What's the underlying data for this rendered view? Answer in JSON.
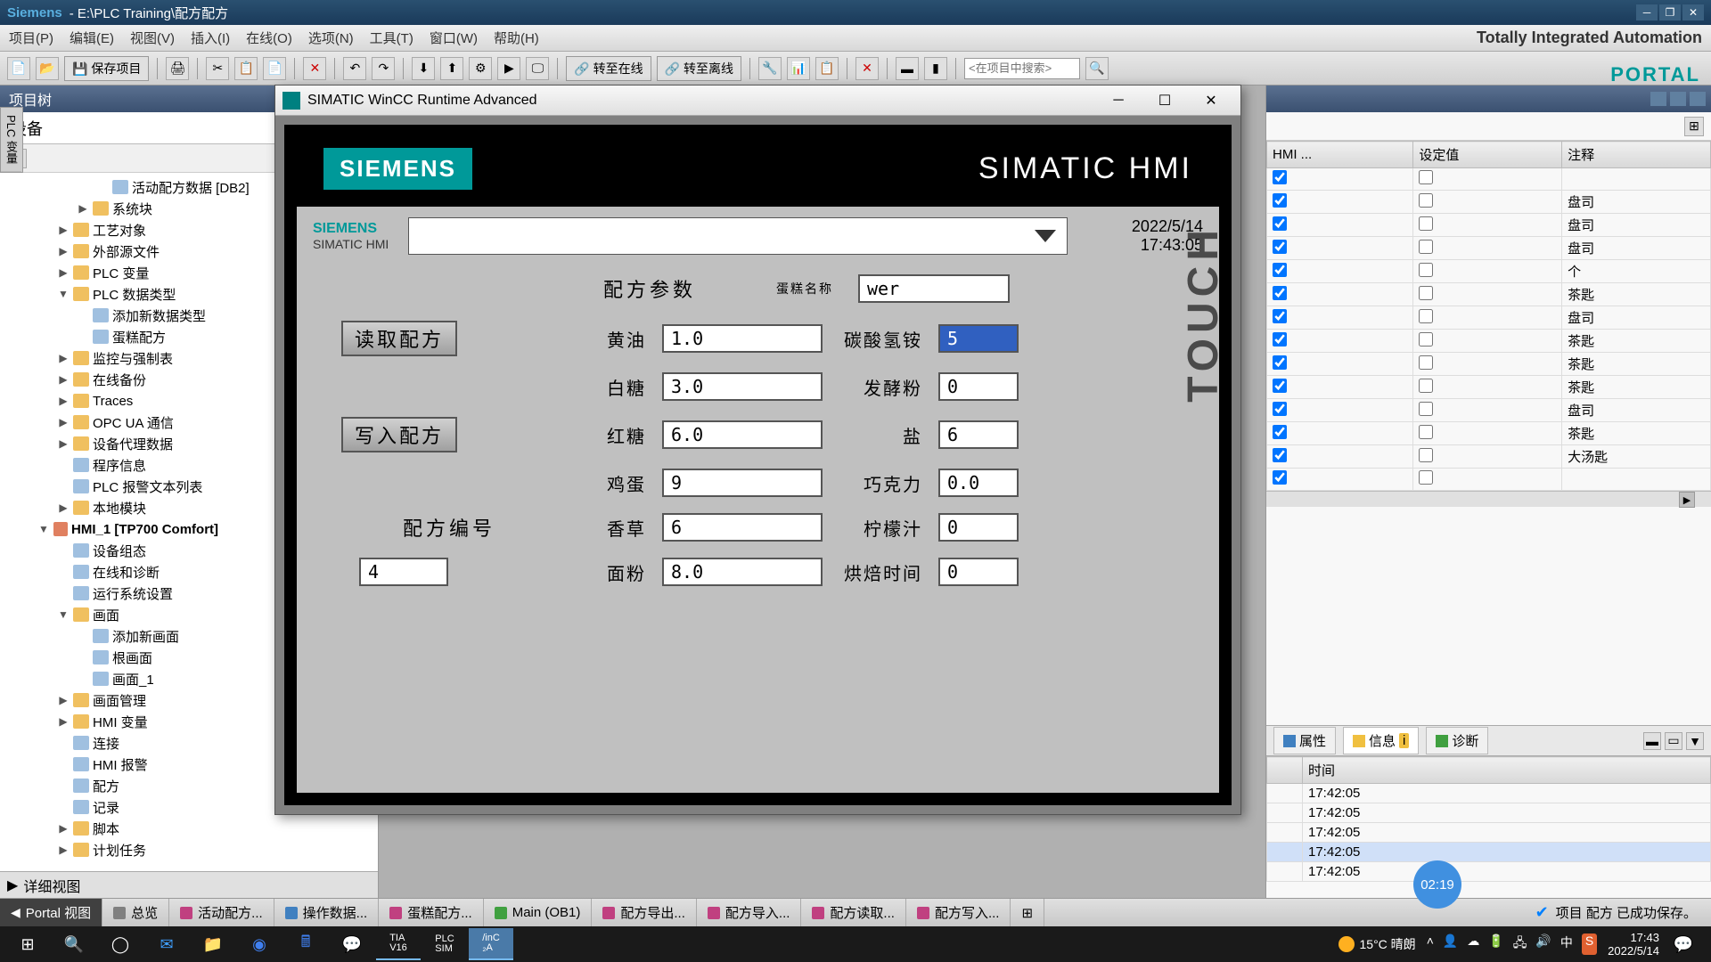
{
  "titlebar": {
    "logo": "Siemens",
    "path": "- E:\\PLC Training\\配方配方"
  },
  "menubar": {
    "items": [
      "项目(P)",
      "编辑(E)",
      "视图(V)",
      "插入(I)",
      "在线(O)",
      "选项(N)",
      "工具(T)",
      "窗口(W)",
      "帮助(H)"
    ],
    "brand": "Totally Integrated Automation"
  },
  "toolbar": {
    "save": "保存项目",
    "online": "转至在线",
    "offline": "转至离线",
    "search_placeholder": "<在项目中搜索>",
    "portal": "PORTAL"
  },
  "tree": {
    "title": "项目树",
    "device_tab": "设备",
    "detail": "详细视图",
    "left_rail": "PLC 变量",
    "nodes": [
      {
        "indent": 4,
        "icon": "file",
        "label": "活动配方数据 [DB2]"
      },
      {
        "indent": 3,
        "exp": "▶",
        "icon": "folder",
        "label": "系统块"
      },
      {
        "indent": 2,
        "exp": "▶",
        "icon": "folder",
        "label": "工艺对象"
      },
      {
        "indent": 2,
        "exp": "▶",
        "icon": "folder",
        "label": "外部源文件"
      },
      {
        "indent": 2,
        "exp": "▶",
        "icon": "folder",
        "label": "PLC 变量"
      },
      {
        "indent": 2,
        "exp": "▼",
        "icon": "folder",
        "label": "PLC 数据类型"
      },
      {
        "indent": 3,
        "icon": "file",
        "label": "添加新数据类型"
      },
      {
        "indent": 3,
        "icon": "file",
        "label": "蛋糕配方"
      },
      {
        "indent": 2,
        "exp": "▶",
        "icon": "folder",
        "label": "监控与强制表"
      },
      {
        "indent": 2,
        "exp": "▶",
        "icon": "folder",
        "label": "在线备份"
      },
      {
        "indent": 2,
        "exp": "▶",
        "icon": "folder",
        "label": "Traces"
      },
      {
        "indent": 2,
        "exp": "▶",
        "icon": "folder",
        "label": "OPC UA 通信"
      },
      {
        "indent": 2,
        "exp": "▶",
        "icon": "folder",
        "label": "设备代理数据"
      },
      {
        "indent": 2,
        "icon": "file",
        "label": "程序信息"
      },
      {
        "indent": 2,
        "icon": "file",
        "label": "PLC 报警文本列表"
      },
      {
        "indent": 2,
        "exp": "▶",
        "icon": "folder",
        "label": "本地模块"
      },
      {
        "indent": 1,
        "exp": "▼",
        "icon": "hmi",
        "label": "HMI_1 [TP700 Comfort]",
        "bold": true
      },
      {
        "indent": 2,
        "icon": "file",
        "label": "设备组态"
      },
      {
        "indent": 2,
        "icon": "file",
        "label": "在线和诊断"
      },
      {
        "indent": 2,
        "icon": "file",
        "label": "运行系统设置"
      },
      {
        "indent": 2,
        "exp": "▼",
        "icon": "folder",
        "label": "画面"
      },
      {
        "indent": 3,
        "icon": "file",
        "label": "添加新画面"
      },
      {
        "indent": 3,
        "icon": "file",
        "label": "根画面"
      },
      {
        "indent": 3,
        "icon": "file",
        "label": "画面_1"
      },
      {
        "indent": 2,
        "exp": "▶",
        "icon": "folder",
        "label": "画面管理"
      },
      {
        "indent": 2,
        "exp": "▶",
        "icon": "folder",
        "label": "HMI 变量"
      },
      {
        "indent": 2,
        "icon": "file",
        "label": "连接"
      },
      {
        "indent": 2,
        "icon": "file",
        "label": "HMI 报警"
      },
      {
        "indent": 2,
        "icon": "file",
        "label": "配方"
      },
      {
        "indent": 2,
        "icon": "file",
        "label": "记录"
      },
      {
        "indent": 2,
        "exp": "▶",
        "icon": "folder",
        "label": "脚本"
      },
      {
        "indent": 2,
        "exp": "▶",
        "icon": "folder",
        "label": "计划任务"
      }
    ]
  },
  "runtime": {
    "title": "SIMATIC WinCC Runtime Advanced",
    "siemens": "SIEMENS",
    "hmi": "SIMATIC HMI",
    "mini_siemens": "SIEMENS",
    "mini_sub": "SIMATIC HMI",
    "touch": "TOUCH",
    "date": "2022/5/14",
    "time": "17:43:05",
    "form": {
      "header_label": "配方参数",
      "name_label": "蛋糕名称",
      "name_val": "wer",
      "read_btn": "读取配方",
      "write_btn": "写入配方",
      "recipe_no_label": "配方编号",
      "recipe_no_val": "4",
      "rows": [
        {
          "l1": "黄油",
          "v1": "1.0",
          "l2": "碳酸氢铵",
          "v2": "5",
          "sel": true
        },
        {
          "l1": "白糖",
          "v1": "3.0",
          "l2": "发酵粉",
          "v2": "0"
        },
        {
          "l1": "红糖",
          "v1": "6.0",
          "l2": "盐",
          "v2": "6"
        },
        {
          "l1": "鸡蛋",
          "v1": "9",
          "l2": "巧克力",
          "v2": "0.0"
        },
        {
          "l1": "香草",
          "v1": "6",
          "l2": "柠檬汁",
          "v2": "0"
        },
        {
          "l1": "面粉",
          "v1": "8.0",
          "l2": "烘焙时间",
          "v2": "0"
        }
      ]
    }
  },
  "right": {
    "headers": [
      "HMI ...",
      "设定值",
      "注释"
    ],
    "rows": [
      {
        "c1": true,
        "c2": false,
        "note": ""
      },
      {
        "c1": true,
        "c2": false,
        "note": "盘司"
      },
      {
        "c1": true,
        "c2": false,
        "note": "盘司"
      },
      {
        "c1": true,
        "c2": false,
        "note": "盘司"
      },
      {
        "c1": true,
        "c2": false,
        "note": "个"
      },
      {
        "c1": true,
        "c2": false,
        "note": "茶匙"
      },
      {
        "c1": true,
        "c2": false,
        "note": "盘司"
      },
      {
        "c1": true,
        "c2": false,
        "note": "茶匙"
      },
      {
        "c1": true,
        "c2": false,
        "note": "茶匙"
      },
      {
        "c1": true,
        "c2": false,
        "note": "茶匙"
      },
      {
        "c1": true,
        "c2": false,
        "note": "盘司"
      },
      {
        "c1": true,
        "c2": false,
        "note": "茶匙"
      },
      {
        "c1": true,
        "c2": false,
        "note": "大汤匙"
      },
      {
        "c1": true,
        "c2": false,
        "note": ""
      }
    ],
    "tabs": {
      "prop": "属性",
      "info": "信息",
      "diag": "诊断"
    },
    "msg_header": "时间",
    "msg_times": [
      "17:42:05",
      "17:42:05",
      "17:42:05",
      "17:42:05",
      "17:42:05"
    ]
  },
  "bottom": {
    "portal": "Portal 视图",
    "tabs": [
      {
        "color": "#808080",
        "label": "总览"
      },
      {
        "color": "#c04080",
        "label": "活动配方..."
      },
      {
        "color": "#4080c0",
        "label": "操作数据..."
      },
      {
        "color": "#c04080",
        "label": "蛋糕配方..."
      },
      {
        "color": "#40a040",
        "label": "Main (OB1)"
      },
      {
        "color": "#c04080",
        "label": "配方导出..."
      },
      {
        "color": "#c04080",
        "label": "配方导入..."
      },
      {
        "color": "#c04080",
        "label": "配方读取..."
      },
      {
        "color": "#c04080",
        "label": "配方写入..."
      }
    ],
    "status": "项目 配方 已成功保存。"
  },
  "taskbar": {
    "weather": "15°C 晴朗",
    "ime": "中",
    "time": "17:43",
    "date": "2022/5/14"
  },
  "timer": "02:19"
}
